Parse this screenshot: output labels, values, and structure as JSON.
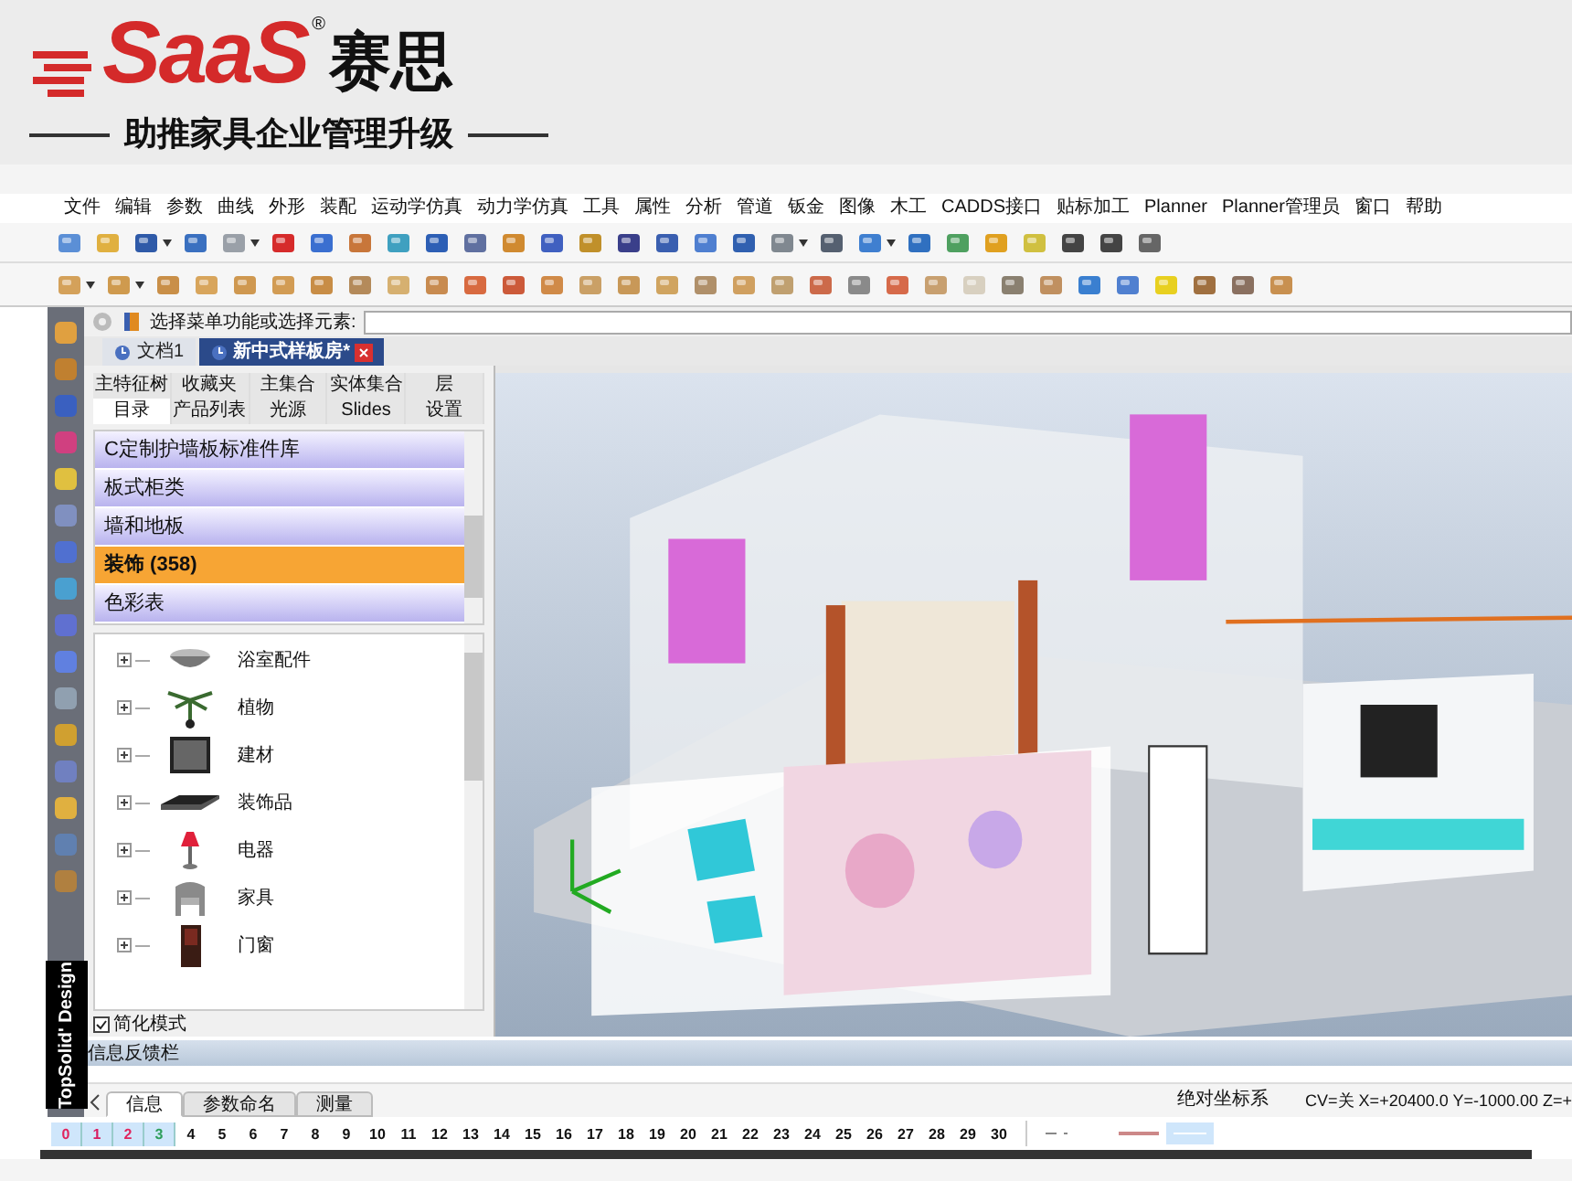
{
  "logo": {
    "brand": "SaaS",
    "registered": "®",
    "name": "赛思",
    "tagline": "助推家具企业管理升级"
  },
  "menu": [
    "文件",
    "编辑",
    "参数",
    "曲线",
    "外形",
    "装配",
    "运动学仿真",
    "动力学仿真",
    "工具",
    "属性",
    "分析",
    "管道",
    "钣金",
    "图像",
    "木工",
    "CADDS接口",
    "贴标加工",
    "Planner",
    "Planner管理员",
    "窗口",
    "帮助"
  ],
  "command_line": {
    "label": "选择菜单功能或选择元素:"
  },
  "doc_tabs": [
    {
      "label": "文档1",
      "selected": false
    },
    {
      "label": "新中式样板房*",
      "selected": true
    }
  ],
  "panel_tabs_row1": [
    {
      "label": "主特征树",
      "selected": false
    },
    {
      "label": "收藏夹",
      "selected": false
    },
    {
      "label": "主集合",
      "selected": false
    },
    {
      "label": "实体集合",
      "selected": false
    },
    {
      "label": "层",
      "selected": false
    }
  ],
  "panel_tabs_row2": [
    {
      "label": "目录",
      "selected": true
    },
    {
      "label": "产品列表",
      "selected": false
    },
    {
      "label": "光源",
      "selected": false
    },
    {
      "label": "Slides",
      "selected": false
    },
    {
      "label": "设置",
      "selected": false
    }
  ],
  "categories": [
    {
      "label": "C定制护墙板标准件库",
      "selected": false
    },
    {
      "label": "板式柜类",
      "selected": false
    },
    {
      "label": "墙和地板",
      "selected": false
    },
    {
      "label": "装饰 (358)",
      "selected": true
    },
    {
      "label": "色彩表",
      "selected": false
    }
  ],
  "tree": [
    {
      "label": "浴室配件",
      "expanded": false
    },
    {
      "label": "植物",
      "expanded": false
    },
    {
      "label": "建材",
      "expanded": false
    },
    {
      "label": "装饰品",
      "expanded": false
    },
    {
      "label": "电器",
      "expanded": false
    },
    {
      "label": "家具",
      "expanded": false
    },
    {
      "label": "门窗",
      "expanded": false
    }
  ],
  "simplified_mode": {
    "label": "简化模式",
    "checked": true
  },
  "side_label": "TopSolid' Design",
  "info_bar": {
    "title": "信息反馈栏"
  },
  "bottom_tabs": [
    {
      "label": "信息",
      "selected": true
    },
    {
      "label": "参数命名",
      "selected": false
    },
    {
      "label": "测量",
      "selected": false
    }
  ],
  "status": {
    "coordinate_system": "绝对坐标系",
    "coordinates": "CV=关 X=+20400.0 Y=-1000.00 Z=+"
  },
  "layers": [
    {
      "label": "0",
      "selected": true,
      "color": "#e0245e"
    },
    {
      "label": "1",
      "selected": true,
      "color": "#d81b60"
    },
    {
      "label": "2",
      "selected": true,
      "color": "#e0245e"
    },
    {
      "label": "3",
      "selected": true,
      "color": "#2e9e5b"
    },
    {
      "label": "4",
      "selected": false,
      "color": "#111111"
    },
    {
      "label": "5",
      "selected": false,
      "color": "#111111"
    },
    {
      "label": "6",
      "selected": false,
      "color": "#111111"
    },
    {
      "label": "7",
      "selected": false,
      "color": "#111111"
    },
    {
      "label": "8",
      "selected": false,
      "color": "#111111"
    },
    {
      "label": "9",
      "selected": false,
      "color": "#111111"
    },
    {
      "label": "10",
      "selected": false,
      "color": "#111111"
    },
    {
      "label": "11",
      "selected": false,
      "color": "#111111"
    },
    {
      "label": "12",
      "selected": false,
      "color": "#111111"
    },
    {
      "label": "13",
      "selected": false,
      "color": "#111111"
    },
    {
      "label": "14",
      "selected": false,
      "color": "#111111"
    },
    {
      "label": "15",
      "selected": false,
      "color": "#111111"
    },
    {
      "label": "16",
      "selected": false,
      "color": "#111111"
    },
    {
      "label": "17",
      "selected": false,
      "color": "#111111"
    },
    {
      "label": "18",
      "selected": false,
      "color": "#111111"
    },
    {
      "label": "19",
      "selected": false,
      "color": "#111111"
    },
    {
      "label": "20",
      "selected": false,
      "color": "#111111"
    },
    {
      "label": "21",
      "selected": false,
      "color": "#111111"
    },
    {
      "label": "22",
      "selected": false,
      "color": "#111111"
    },
    {
      "label": "23",
      "selected": false,
      "color": "#111111"
    },
    {
      "label": "24",
      "selected": false,
      "color": "#111111"
    },
    {
      "label": "25",
      "selected": false,
      "color": "#111111"
    },
    {
      "label": "26",
      "selected": false,
      "color": "#111111"
    },
    {
      "label": "27",
      "selected": false,
      "color": "#111111"
    },
    {
      "label": "28",
      "selected": false,
      "color": "#111111"
    },
    {
      "label": "29",
      "selected": false,
      "color": "#111111"
    },
    {
      "label": "30",
      "selected": false,
      "color": "#111111"
    }
  ]
}
